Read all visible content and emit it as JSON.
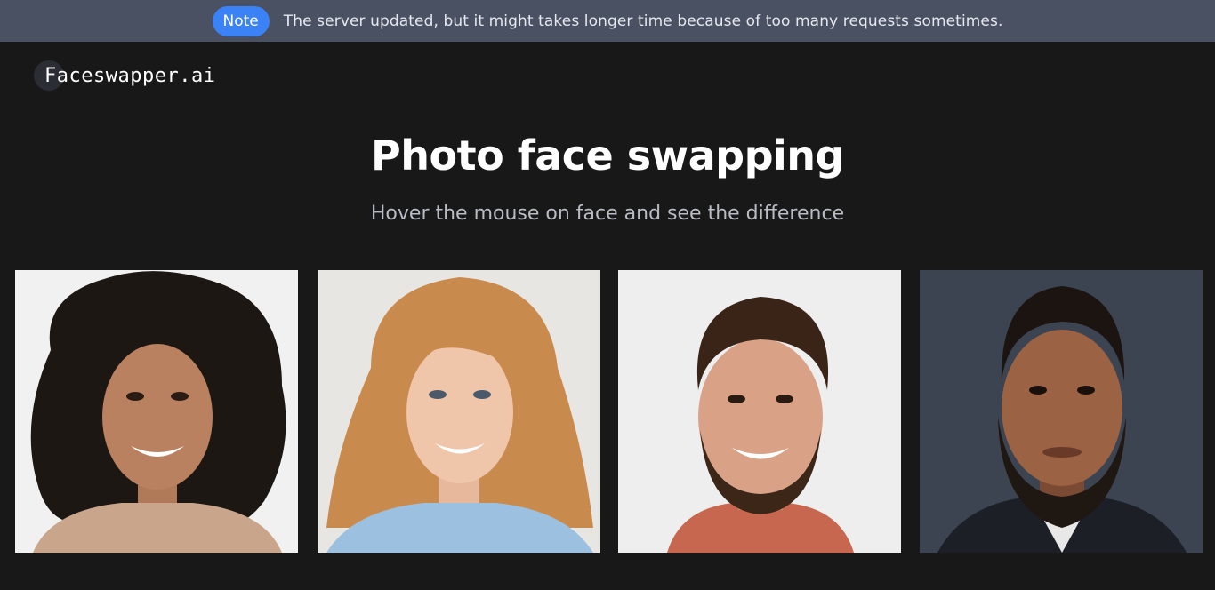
{
  "notice": {
    "badge": "Note",
    "text": "The server updated, but it might takes longer time because of too many requests sometimes."
  },
  "brand": {
    "name": "Faceswapper.ai"
  },
  "hero": {
    "title": "Photo face swapping",
    "subtitle": "Hover the mouse on face and see the difference"
  },
  "gallery": {
    "photos": [
      {
        "name": "face-photo-1"
      },
      {
        "name": "face-photo-2"
      },
      {
        "name": "face-photo-3"
      },
      {
        "name": "face-photo-4"
      }
    ]
  },
  "colors": {
    "background": "#181818",
    "notice_bar": "#4a5163",
    "badge": "#3b82f6"
  }
}
